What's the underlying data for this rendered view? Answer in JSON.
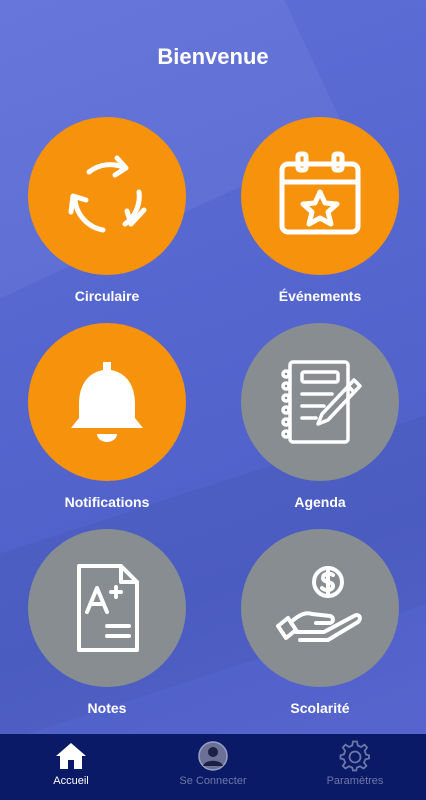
{
  "header": {
    "title": "Bienvenue"
  },
  "tiles": [
    {
      "label": "Circulaire",
      "icon": "recycle-arrows-icon",
      "color": "#f6920c"
    },
    {
      "label": "Événements",
      "icon": "calendar-star-icon",
      "color": "#f6920c"
    },
    {
      "label": "Notifications",
      "icon": "bell-icon",
      "color": "#f6920c"
    },
    {
      "label": "Agenda",
      "icon": "notebook-pen-icon",
      "color": "#878d91"
    },
    {
      "label": "Notes",
      "icon": "grade-document-icon",
      "color": "#878d91"
    },
    {
      "label": "Scolarité",
      "icon": "hand-dollar-icon",
      "color": "#878d91"
    }
  ],
  "bottom_nav": {
    "items": [
      {
        "label": "Accueil",
        "icon": "home-icon",
        "active": true
      },
      {
        "label": "Se Connecter",
        "icon": "user-avatar-icon",
        "active": false
      },
      {
        "label": "Paramètres",
        "icon": "gear-icon",
        "active": false
      }
    ]
  },
  "colors": {
    "background": "#5566cf",
    "accent_orange": "#f6920c",
    "inactive_grey": "#878d91",
    "nav_bar": "#0a1a66"
  }
}
